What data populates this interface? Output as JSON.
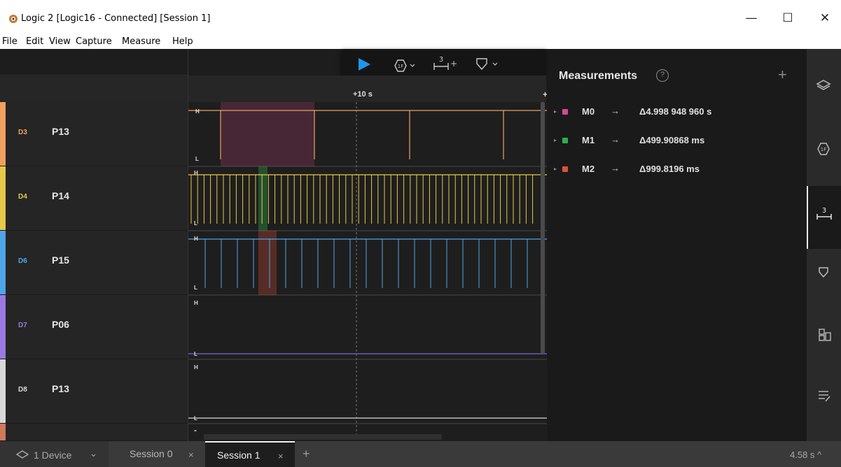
{
  "window": {
    "title": "Logic 2 [Logic16 - Connected] [Session 1]",
    "minimize": "—",
    "maximize": "☐",
    "close": "✕"
  },
  "menu": [
    "File",
    "Edit",
    "View",
    "Capture",
    "Measure",
    "Help"
  ],
  "toolbar": {
    "play": "play-icon",
    "analyzer": "analyzer-icon",
    "measure_num": "3",
    "measure_plus": "+",
    "marker": "marker-icon"
  },
  "timeline": {
    "label": "+10 s"
  },
  "channels": [
    {
      "id": "D3",
      "name": "P13",
      "color": "#f0a060",
      "high": "H",
      "low": "L"
    },
    {
      "id": "D4",
      "name": "P14",
      "color": "#e6c84a",
      "high": "H",
      "low": "L"
    },
    {
      "id": "D6",
      "name": "P15",
      "color": "#4ea6e8",
      "high": "H",
      "low": "L"
    },
    {
      "id": "D7",
      "name": "P06",
      "color": "#9a7ae0",
      "high": "H",
      "low": "L"
    },
    {
      "id": "D8",
      "name": "P13",
      "color": "#d8d8d8",
      "high": "H",
      "low": "L"
    }
  ],
  "measurements": {
    "title": "Measurements",
    "help": "?",
    "add": "+",
    "items": [
      {
        "name": "M0",
        "arrow": "→",
        "value": "Δ4.998 948 960 s",
        "color": "#d9488f"
      },
      {
        "name": "M1",
        "arrow": "→",
        "value": "Δ499.90868 ms",
        "color": "#2bb34a"
      },
      {
        "name": "M2",
        "arrow": "→",
        "value": "Δ999.8196 ms",
        "color": "#e0503c"
      }
    ]
  },
  "rail": [
    "layers-icon",
    "analyzer-icon",
    "measure-icon",
    "marker-icon",
    "extensions-icon",
    "notes-icon"
  ],
  "status": {
    "device": "1 Device",
    "device_caret": "⌄",
    "tabs": [
      {
        "label": "Session 0",
        "close": "×",
        "active": false
      },
      {
        "label": "Session 1",
        "close": "×",
        "active": true
      }
    ],
    "add_tab": "+",
    "right": "4.58 s ^"
  }
}
